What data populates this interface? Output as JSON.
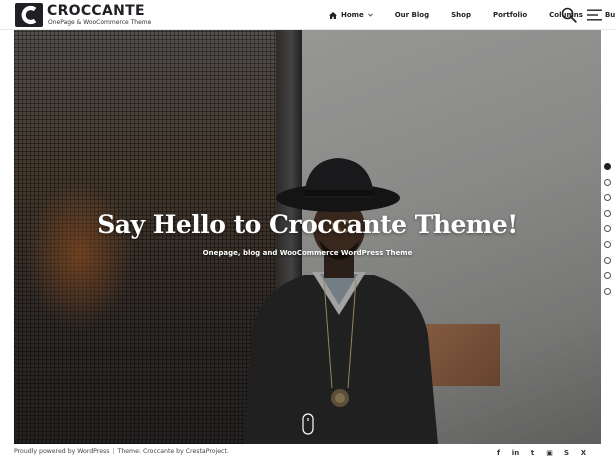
{
  "header": {
    "logo_title": "CROCCANTE",
    "logo_tagline": "OnePage & WooCommerce Theme",
    "nav": [
      {
        "label": "Home"
      },
      {
        "label": "Our Blog"
      },
      {
        "label": "Shop"
      },
      {
        "label": "Portfolio"
      },
      {
        "label": "Columns"
      },
      {
        "label": "Buttons"
      }
    ],
    "search_icon": "search-icon",
    "menu_icon": "hamburger-icon"
  },
  "hero": {
    "title": "Say Hello to Croccante Theme!",
    "subtitle": "Onepage, blog and WooCommerce WordPress Theme",
    "plaque_text": "",
    "scroll_icon": "mouse-scroll-icon"
  },
  "slide_dots": {
    "count": 9,
    "active_index": 0
  },
  "footer": {
    "powered": "Proudly powered by WordPress",
    "separator": "|",
    "theme": "Theme: Croccante by CrestaProject.",
    "socials": [
      {
        "icon": "facebook-icon",
        "glyph": "f"
      },
      {
        "icon": "linkedin-icon",
        "glyph": "in"
      },
      {
        "icon": "tumblr-icon",
        "glyph": "t"
      },
      {
        "icon": "flickr-icon",
        "glyph": "▣"
      },
      {
        "icon": "skype-icon",
        "glyph": "S"
      },
      {
        "icon": "xing-icon",
        "glyph": "X"
      }
    ]
  },
  "colors": {
    "text_dark": "#222222",
    "hero_text": "#ffffff",
    "footer_text": "#444444",
    "plaque": "#9a6a4a"
  }
}
